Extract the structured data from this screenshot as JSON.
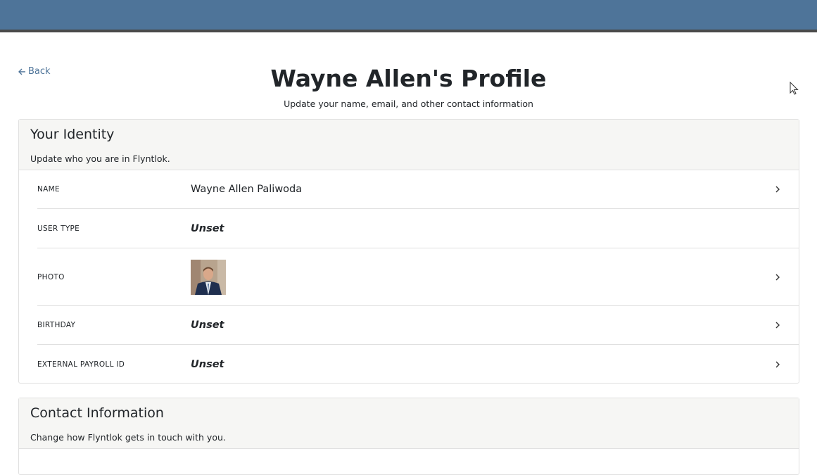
{
  "header": {
    "back_label": "Back",
    "title": "Wayne Allen's Profile",
    "subtitle": "Update your name, email, and other contact information"
  },
  "identity": {
    "title": "Your Identity",
    "description": "Update who you are in Flyntlok.",
    "rows": [
      {
        "label": "NAME",
        "value": "Wayne Allen Paliwoda"
      },
      {
        "label": "USER TYPE",
        "value": "Unset"
      },
      {
        "label": "PHOTO",
        "value": ""
      },
      {
        "label": "BIRTHDAY",
        "value": "Unset"
      },
      {
        "label": "EXTERNAL PAYROLL ID",
        "value": "Unset"
      }
    ]
  },
  "contact": {
    "title": "Contact Information",
    "description": "Change how Flyntlok gets in touch with you."
  },
  "colors": {
    "topbar": "#4e7499",
    "link": "#4e7499",
    "card_header_bg": "#f6f6f4"
  },
  "icons": [
    "arrow-left-icon",
    "chevron-right-icon",
    "mouse-cursor-icon",
    "profile-photo"
  ]
}
